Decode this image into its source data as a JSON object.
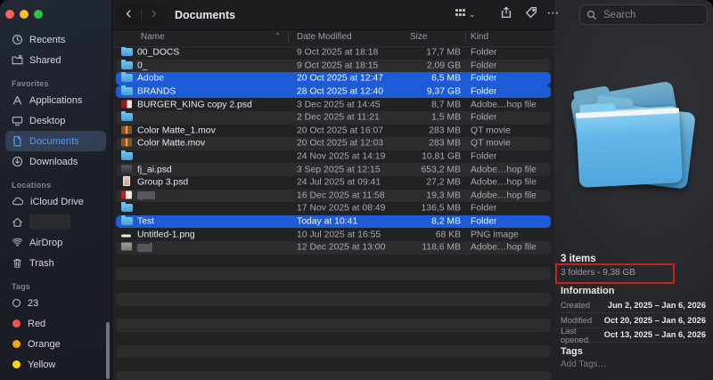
{
  "window": {
    "title": "Documents"
  },
  "toolbar": {
    "nav_icons": [
      "chevron-left",
      "chevron-right"
    ],
    "view_modes": [
      {
        "name": "icon-view",
        "selected": false
      },
      {
        "name": "list-view",
        "selected": true
      },
      {
        "name": "column-view",
        "selected": false
      },
      {
        "name": "gallery-view",
        "selected": false
      }
    ],
    "action_icons": [
      "group-by",
      "share",
      "tag",
      "more"
    ],
    "search": {
      "placeholder": "Search",
      "icon": "magnifier"
    }
  },
  "sidebar": {
    "sections": [
      {
        "label": "",
        "items": [
          {
            "label": "Recents",
            "icon": "clock"
          },
          {
            "label": "Shared",
            "icon": "shared-folder"
          }
        ]
      },
      {
        "label": "Favorites",
        "items": [
          {
            "label": "Applications",
            "icon": "applications"
          },
          {
            "label": "Desktop",
            "icon": "desktop"
          },
          {
            "label": "Documents",
            "icon": "document",
            "selected": true
          },
          {
            "label": "Downloads",
            "icon": "downloads"
          }
        ]
      },
      {
        "label": "Locations",
        "items": [
          {
            "label": "iCloud Drive",
            "icon": "cloud"
          },
          {
            "label": "",
            "icon": "home",
            "redacted": true
          },
          {
            "label": "AirDrop",
            "icon": "airdrop"
          },
          {
            "label": "Trash",
            "icon": "trash"
          }
        ]
      },
      {
        "label": "Tags",
        "items": [
          {
            "label": "23",
            "dot": "outline"
          },
          {
            "label": "Red",
            "dot": "#f4544d"
          },
          {
            "label": "Orange",
            "dot": "#f7a50c"
          },
          {
            "label": "Yellow",
            "dot": "#fbd60a"
          }
        ]
      }
    ]
  },
  "list": {
    "columns": [
      "Name",
      "Date Modified",
      "Size",
      "Kind"
    ],
    "sort_icon": "chevron-up",
    "rows": [
      {
        "name": "00_DOCS",
        "icon": "folder",
        "date": "9 Oct 2025 at 18:18",
        "size": "17,7 MB",
        "kind": "Folder"
      },
      {
        "name": "0_",
        "redacted": true,
        "redact_w": 48,
        "icon": "folder",
        "date": "9 Oct 2025 at 18:15",
        "size": "2,09 GB",
        "kind": "Folder"
      },
      {
        "name": "Adobe",
        "icon": "folder",
        "selected": true,
        "date": "20 Oct 2025 at 12:47",
        "size": "6,5 MB",
        "kind": "Folder"
      },
      {
        "name": "BRANDS",
        "icon": "folder",
        "selected": true,
        "date": "28 Oct 2025 at 12:40",
        "size": "9,37 GB",
        "kind": "Folder"
      },
      {
        "name": "BURGER_KING copy 2.psd",
        "icon": "psd-burger",
        "date": "3 Dec 2025 at 14:45",
        "size": "8,7 MB",
        "kind": "Adobe…hop file"
      },
      {
        "name": "",
        "redacted": true,
        "redact_w": 58,
        "icon": "folder",
        "date": "2 Dec 2025 at 11:21",
        "size": "1,5 MB",
        "kind": "Folder"
      },
      {
        "name": "Color Matte_1.mov",
        "icon": "mov",
        "date": "20 Oct 2025 at 16:07",
        "size": "283 MB",
        "kind": "QT movie"
      },
      {
        "name": "Color Matte.mov",
        "icon": "mov",
        "date": "20 Oct 2025 at 12:03",
        "size": "283 MB",
        "kind": "QT movie"
      },
      {
        "name": "",
        "redacted": true,
        "redact_w": 40,
        "icon": "folder",
        "date": "24 Nov 2025 at 14:19",
        "size": "10,81 GB",
        "kind": "Folder"
      },
      {
        "name": "fj_ai.psd",
        "icon": "psd-dark",
        "date": "3 Sep 2025 at 12:15",
        "size": "653,2 MB",
        "kind": "Adobe…hop file"
      },
      {
        "name": "Group 3.psd",
        "icon": "psd-pink",
        "date": "24 Jul 2025 at 09:41",
        "size": "27,2 MB",
        "kind": "Adobe…hop file"
      },
      {
        "name": "",
        "redacted": true,
        "redact_w": 42,
        "suffix": ".psd",
        "icon": "psd-red",
        "date": "16 Dec 2025 at 11:58",
        "size": "19,3 MB",
        "kind": "Adobe…hop file"
      },
      {
        "name": "",
        "redacted": true,
        "redact_w": 36,
        "icon": "folder",
        "date": "17 Nov 2025 at 08:49",
        "size": "136,5 MB",
        "kind": "Folder"
      },
      {
        "name": "Test",
        "icon": "folder",
        "selected": true,
        "date": "Today at 10:41",
        "size": "8,2 MB",
        "kind": "Folder"
      },
      {
        "name": "Untitled-1.png",
        "icon": "png-dash",
        "date": "10 Jul 2025 at 16:55",
        "size": "68 KB",
        "kind": "PNG image"
      },
      {
        "name": "",
        "redacted": true,
        "redact_w": 40,
        "suffix": "psd",
        "icon": "psd-gray",
        "date": "12 Dec 2025 at 13:00",
        "size": "118,6 MB",
        "kind": "Adobe…hop file"
      }
    ]
  },
  "preview": {
    "icon": "folder-stack",
    "items_count": "3 items",
    "summary": "3 folders - 9,38 GB",
    "annotation_color": "#c5231c",
    "information_label": "Information",
    "info_rows": [
      {
        "label": "Created",
        "value": "Jun 2, 2025 – Jan 6, 2026"
      },
      {
        "label": "Modified",
        "value": "Oct 20, 2025 – Jan 6, 2026"
      },
      {
        "label": "Last opened",
        "value": "Oct 13, 2025 – Jan 6, 2026"
      }
    ],
    "tags_label": "Tags",
    "add_tags_placeholder": "Add Tags…"
  },
  "colors": {
    "selection_blue": "#1d5cd6",
    "sidebar_accent": "#4b9cf8",
    "folder_blue": "#5fb3e6",
    "annotation_red": "#c5231c"
  }
}
